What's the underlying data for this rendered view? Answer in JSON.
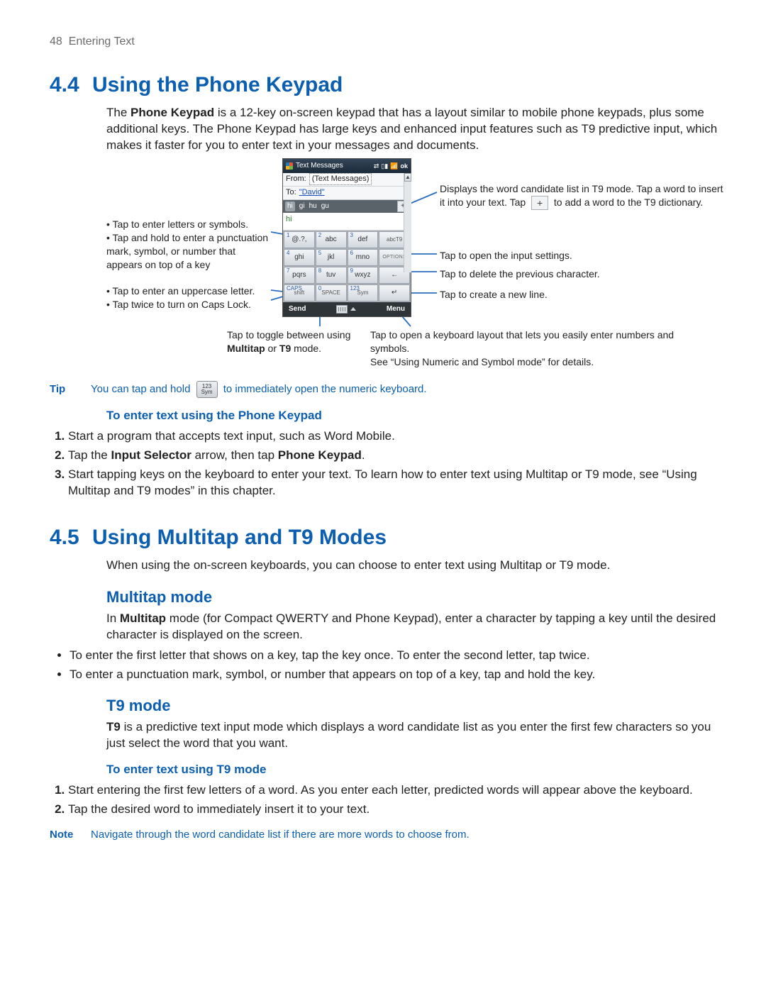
{
  "page": {
    "number": "48",
    "running": "Entering Text"
  },
  "s44": {
    "num": "4.4",
    "title": "Using the Phone Keypad",
    "intro_pre": "The ",
    "intro_bold": "Phone Keypad",
    "intro_post": " is a 12-key on-screen keypad that has a layout similar to mobile phone keypads, plus some additional keys. The Phone Keypad has large keys and enhanced input features such as T9 predictive input, which makes it faster for you to enter text in your messages and documents."
  },
  "callouts": {
    "left1": "Tap to enter letters or symbols.",
    "left2": "Tap and hold to enter a punctuation mark, symbol, or number that appears on top of a key",
    "left3": "Tap to enter an uppercase letter.",
    "left4": "Tap twice to turn on Caps Lock.",
    "right1a": "Displays the word candidate list in T9 mode. Tap a word to insert it into your text. Tap ",
    "right1b": " to add a word to the T9 dictionary.",
    "right2": "Tap to open the input settings.",
    "right3": "Tap to delete the previous character.",
    "right4": "Tap to create a new line.",
    "bot1a": "Tap to toggle between using ",
    "bot1b": "Multitap",
    "bot1c": " or ",
    "bot1d": "T9",
    "bot1e": " mode.",
    "bot2a": "Tap to open a keyboard layout that lets you easily enter numbers and symbols.",
    "bot2b": "See “Using Numeric and Symbol mode” for details."
  },
  "phone": {
    "title": "Text Messages",
    "ok": "ok",
    "status": [
      "⇄",
      "▮▯",
      "📶"
    ],
    "from_label": "From:",
    "from_value": "(Text Messages)",
    "to_label": "To:",
    "to_value": "\"David\"",
    "candidates": [
      "hi",
      "gi",
      "hu",
      "gu"
    ],
    "compose": "hi",
    "keys": [
      {
        "n": "1",
        "t": "@.?,"
      },
      {
        "n": "2",
        "t": "abc"
      },
      {
        "n": "3",
        "t": "def"
      },
      {
        "n": "",
        "t": "abcT9",
        "cls": "small"
      },
      {
        "n": "4",
        "t": "ghi"
      },
      {
        "n": "5",
        "t": "jkl"
      },
      {
        "n": "6",
        "t": "mno"
      },
      {
        "n": "",
        "t": "OPTIONS",
        "cls": "options"
      },
      {
        "n": "7",
        "t": "pqrs"
      },
      {
        "n": "8",
        "t": "tuv"
      },
      {
        "n": "9",
        "t": "wxyz"
      },
      {
        "n": "",
        "t": "←",
        "cls": ""
      },
      {
        "n": "CAPS",
        "t": "shift",
        "cls": "small"
      },
      {
        "n": "0",
        "t": "SPACE",
        "cls": "small"
      },
      {
        "n": "123",
        "t": "Sym",
        "cls": "small"
      },
      {
        "n": "",
        "t": "↵",
        "cls": ""
      }
    ],
    "soft_left": "Send",
    "soft_right": "Menu"
  },
  "tip": {
    "label": "Tip",
    "pre": "You can tap and hold ",
    "chip_top": "123",
    "chip_bot": "Sym",
    "post": " to immediately open the numeric keyboard."
  },
  "s44_sub": {
    "heading": "To enter text using the Phone Keypad",
    "step1": "Start a program that accepts text input, such as Word Mobile.",
    "step2_pre": "Tap the ",
    "step2_b1": "Input Selector",
    "step2_mid": " arrow, then tap ",
    "step2_b2": "Phone Keypad",
    "step2_post": ".",
    "step3": "Start tapping keys on the keyboard to enter your text. To learn how to enter text using Multitap or T9 mode, see “Using Multitap and T9 modes” in this chapter."
  },
  "s45": {
    "num": "4.5",
    "title": "Using Multitap and T9 Modes",
    "intro": "When using the on-screen keyboards, you can choose to enter text using Multitap or T9 mode."
  },
  "multitap": {
    "title": "Multitap mode",
    "p_pre": "In ",
    "p_b": "Multitap",
    "p_post": " mode (for Compact QWERTY and Phone Keypad), enter a character by tapping a key until the desired character is displayed on the screen.",
    "b1": "To enter the first letter that shows on a key, tap the key once. To enter the second letter, tap twice.",
    "b2": "To enter a punctuation mark, symbol, or number that appears on top of a key, tap and hold the key."
  },
  "t9": {
    "title": "T9 mode",
    "p_b": "T9",
    "p_post": " is a predictive text input mode which displays a word candidate list as you enter the first few characters so you just select the word that you want.",
    "sub": "To enter text using T9 mode",
    "s1": "Start entering the first few letters of a word. As you enter each letter, predicted words will appear above the keyboard.",
    "s2": "Tap the desired word to immediately insert it to your text."
  },
  "note": {
    "label": "Note",
    "text": "Navigate through the word candidate list if there are more words to choose from."
  }
}
